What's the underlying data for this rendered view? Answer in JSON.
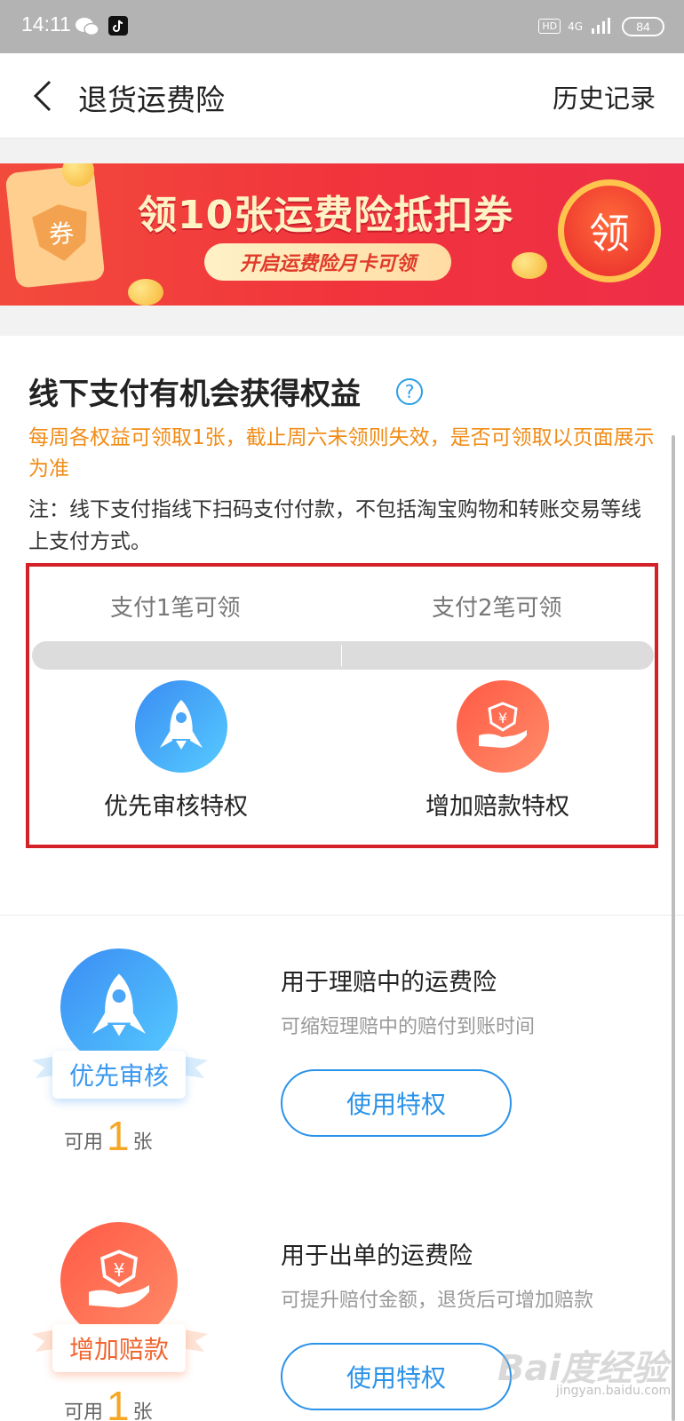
{
  "status_bar": {
    "time": "14:11",
    "hd": "HD",
    "network": "4G",
    "battery": "84"
  },
  "header": {
    "title": "退货运费险",
    "history": "历史记录"
  },
  "banner": {
    "headline": "领10张运费险抵扣券",
    "pill": "开启运费险月卡可领",
    "claim": "领",
    "ticket": "券"
  },
  "section": {
    "title": "线下支付有机会获得权益",
    "help": "?",
    "notice": "每周各权益可领取1张，截止周六未领则失效，是否可领取以页面展示为准",
    "note": "注：线下支付指线下扫码支付付款，不包括淘宝购物和转账交易等线上支付方式。"
  },
  "steps": [
    {
      "condition": "支付1笔可领",
      "privilege": "优先审核特权",
      "icon": "rocket-icon"
    },
    {
      "condition": "支付2笔可领",
      "privilege": "增加赔款特权",
      "icon": "yuan-hand-icon"
    }
  ],
  "cards": [
    {
      "badge": "优先审核",
      "available_prefix": "可用",
      "count": "1",
      "unit": "张",
      "title": "用于理赔中的运费险",
      "desc": "可缩短理赔中的赔付到账时间",
      "button": "使用特权"
    },
    {
      "badge": "增加赔款",
      "available_prefix": "可用",
      "count": "1",
      "unit": "张",
      "title": "用于出单的运费险",
      "desc": "可提升赔付金额，退货后可增加赔款",
      "button": "使用特权"
    }
  ],
  "watermark": {
    "main": "Bai度经验",
    "sub": "jingyan.baidu.com"
  },
  "colors": {
    "accent_blue": "#2a92e9",
    "notice_orange": "#f08c17",
    "highlight_red": "#d42027",
    "count_orange": "#f5a623"
  }
}
